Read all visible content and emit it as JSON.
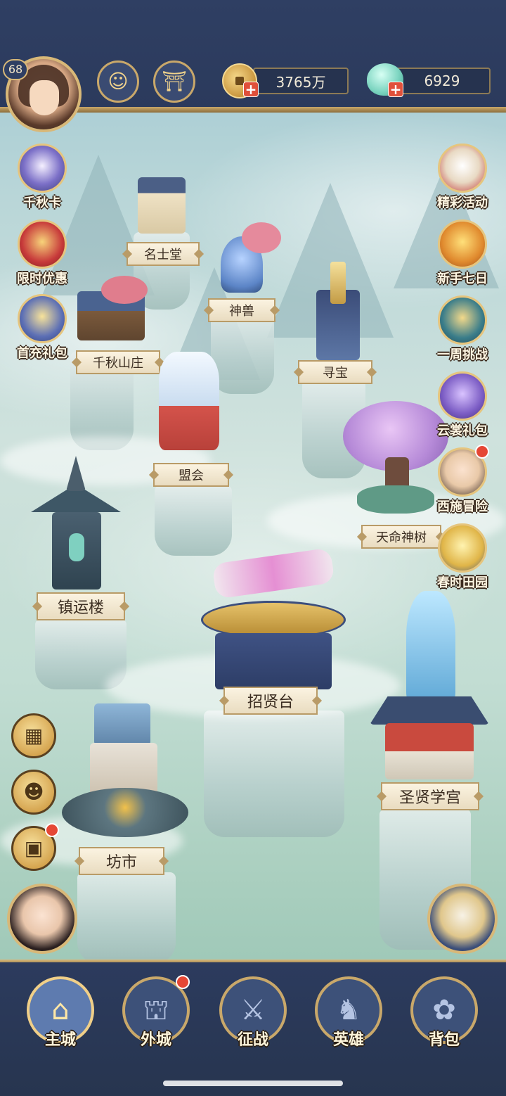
{
  "player": {
    "level": "68",
    "avatar_icon": "player-portrait"
  },
  "topbar": {
    "service_icon": "headset-person-icon",
    "shop_icon": "gate-icon",
    "copper": {
      "value": "3765万",
      "icon": "copper-coin-icon"
    },
    "jade": {
      "value": "6929",
      "icon": "jade-shell-icon"
    }
  },
  "left_icons": [
    {
      "label": "千秋卡",
      "icon": "fan-card-icon"
    },
    {
      "label": "限时优惠",
      "icon": "gift-box-icon"
    },
    {
      "label": "首充礼包",
      "icon": "first-recharge-gift-icon"
    }
  ],
  "right_icons": [
    {
      "label": "精彩活动",
      "icon": "lion-dance-icon"
    },
    {
      "label": "新手七日",
      "icon": "gold-ingot-icon"
    },
    {
      "label": "一周挑战",
      "icon": "scroll-challenge-icon"
    },
    {
      "label": "云裳礼包",
      "icon": "purple-gift-icon"
    },
    {
      "label": "西施冒险",
      "icon": "xishi-portrait-icon"
    },
    {
      "label": "春时田园",
      "icon": "wheat-icon"
    }
  ],
  "buildings": {
    "mingshitang": "名士堂",
    "shenshou": "神兽",
    "qianqiu_shanzhuang": "千秋山庄",
    "xunbao": "寻宝",
    "menghui": "盟会",
    "tianming_shenshu": "天命神树",
    "zhenyunlou": "镇运楼",
    "zhaoxiantai": "招贤台",
    "shengxian_xuegong": "圣贤学宫",
    "fangshi": "坊市"
  },
  "float_buttons": [
    {
      "icon": "cards-icon"
    },
    {
      "icon": "friends-icon"
    },
    {
      "icon": "chat-icon"
    }
  ],
  "bottom_nav": [
    {
      "label": "主城",
      "icon": "palace-icon"
    },
    {
      "label": "外城",
      "icon": "city-wall-icon"
    },
    {
      "label": "征战",
      "icon": "war-drum-icon"
    },
    {
      "label": "英雄",
      "icon": "hero-hat-icon"
    },
    {
      "label": "背包",
      "icon": "bag-icon"
    }
  ],
  "colors": {
    "bar_bg": "#2c3b5e",
    "gold_trim": "#c9a86a",
    "badge_red": "#e54735",
    "plaque_bg": "#fbf3e1"
  }
}
